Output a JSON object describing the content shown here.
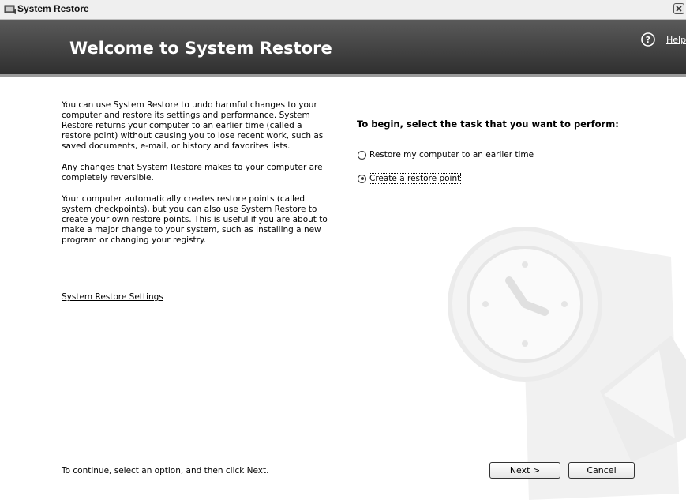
{
  "window": {
    "title": "System Restore"
  },
  "header": {
    "heading": "Welcome to System Restore",
    "help_label": "Help"
  },
  "intro": {
    "paragraphs": [
      "You can use System Restore to undo harmful changes to your computer and restore its settings and performance. System Restore returns your computer to an earlier time (called a restore point) without causing you to lose recent work, such as saved documents, e-mail, or history and favorites lists.",
      "Any changes that System Restore makes to your computer are completely reversible.",
      "Your computer automatically creates restore points (called system checkpoints), but you can also use System Restore to create your own restore points. This is useful if you are about to make a major change to your system, such as installing a new program or changing your registry."
    ],
    "settings_link": "System Restore Settings"
  },
  "task": {
    "prompt": "To begin, select the task that you want to perform:",
    "options": [
      {
        "label": "Restore my computer to an earlier time",
        "checked": false
      },
      {
        "label": "Create a restore point",
        "checked": true
      }
    ]
  },
  "footer": {
    "instruction": "To continue, select an option, and then click Next.",
    "next_label": "Next >",
    "cancel_label": "Cancel"
  },
  "icons": {
    "app": "system-restore-icon",
    "help": "help-icon",
    "close": "close-icon",
    "watermark": "clock-restore-icon"
  }
}
